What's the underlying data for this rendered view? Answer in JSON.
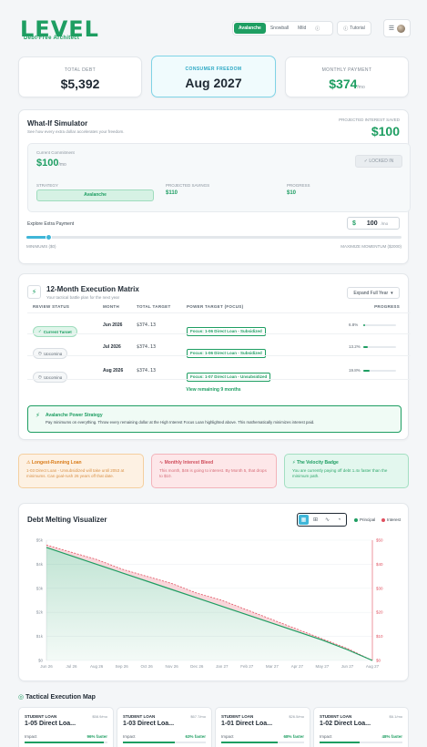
{
  "brand": {
    "name": "LEVEL",
    "tagline": "Debt-Free Architect"
  },
  "strategy_tabs": [
    {
      "label": "Avalanche",
      "active": true
    },
    {
      "label": "Snowball",
      "active": false
    },
    {
      "label": "Mild",
      "active": false
    }
  ],
  "tutorial_label": "Tutorial",
  "stats": {
    "total_debt": {
      "label": "TOTAL DEBT",
      "value": "$5,392"
    },
    "freedom": {
      "label": "CONSUMER FREEDOM",
      "value": "Aug 2027"
    },
    "payment": {
      "label": "MONTHLY PAYMENT",
      "value": "$374",
      "unit": "/mo"
    }
  },
  "simulator": {
    "title": "What-If Simulator",
    "subtitle": "See how every extra dollar accelerates your freedom.",
    "saved_label": "PROJECTED INTEREST SAVED",
    "saved_value": "$100",
    "commitment_label": "Current Commitment",
    "commitment_value": "$100",
    "commitment_unit": "/mo",
    "locked_label": "✓ LOCKED IN",
    "strategy_label": "STRATEGY",
    "strategy_value": "Avalanche",
    "savings_label": "PROJECTED SAVINGS",
    "savings_value": "$110",
    "progress_label": "PROGRESS",
    "progress_value": "$10",
    "explore_label": "Explore Extra Payment",
    "extra_currency": "$",
    "extra_value": "100",
    "extra_unit": "/mo",
    "slider_level": 0.06,
    "min_label": "MINIMUMS ($0)",
    "max_label": "MAXIMIZE MOMENTUM ($2000)"
  },
  "matrix": {
    "title": "12-Month Execution Matrix",
    "subtitle": "Your tactical battle plan for the next year",
    "expand_label": "Expand Full Year",
    "headers": [
      "REVIEW STATUS",
      "MONTH",
      "TOTAL TARGET",
      "POWER TARGET (FOCUS)",
      "PROGRESS"
    ],
    "rows": [
      {
        "status": "Current Target",
        "current": true,
        "month": "Jun 2026",
        "total": "$374.13",
        "focus": "Focus: 1-06 Direct Loan - Subsidized",
        "progress": "6.8%",
        "level": 0.068
      },
      {
        "status": "Upcoming",
        "current": false,
        "month": "Jul 2026",
        "total": "$374.13",
        "focus": "Focus: 1-06 Direct Loan - Subsidized",
        "progress": "13.2%",
        "level": 0.132
      },
      {
        "status": "Upcoming",
        "current": false,
        "month": "Aug 2026",
        "total": "$374.13",
        "focus": "Focus: 1-07 Direct Loan - Unsubsidized",
        "progress": "19.8%",
        "level": 0.198
      }
    ],
    "view_more": "View remaining 9 months",
    "strategy_title": "Avalanche Power Strategy",
    "strategy_body": "Pay minimums on everything. Throw every remaining dollar at the High Interest Focus Loan highlighted above. This mathematically minimizes interest paid."
  },
  "alerts": [
    {
      "title": "Longest-Running Loan",
      "body": "1-03 Direct Loan - Unsubsidized will take until 2053 at minimums. Can goal-rush 26 years off that date."
    },
    {
      "title": "Monthly Interest Bleed",
      "body": "This month, $46 is going to interest. By Month 5, that drops to $10."
    },
    {
      "title": "The Velocity Badge",
      "body": "You are currently paying off debt 1.4x faster than the minimum path."
    }
  ],
  "visualizer": {
    "title": "Debt Melting Visualizer",
    "legend_principal": "Principal",
    "legend_interest": "Interest"
  },
  "chart_data": {
    "type": "area",
    "x": [
      "Jun 26",
      "Jul 26",
      "Aug 26",
      "Sep 26",
      "Oct 26",
      "Nov 26",
      "Dec 26",
      "Jan 27",
      "Feb 27",
      "Mar 27",
      "Apr 27",
      "May 27",
      "Jun 27",
      "Aug 27"
    ],
    "series": [
      {
        "name": "Principal",
        "values": [
          4700,
          4350,
          4000,
          3650,
          3300,
          2950,
          2600,
          2250,
          1900,
          1550,
          1200,
          850,
          450,
          0
        ]
      },
      {
        "name": "Interest",
        "values": [
          48,
          45,
          42,
          38,
          35,
          32,
          28,
          25,
          21,
          17,
          13,
          9,
          5,
          0
        ]
      }
    ],
    "y_left_ticks": [
      "$0",
      "$1k",
      "$2k",
      "$3k",
      "$4k",
      "$5k"
    ],
    "y_right_ticks": [
      "$0",
      "$10",
      "$20",
      "$30",
      "$40",
      "$50"
    ],
    "ylim": [
      0,
      5000
    ],
    "y2lim": [
      0,
      50
    ]
  },
  "tactical": {
    "title": "Tactical Execution Map",
    "cards": [
      {
        "kind": "STUDENT LOAN",
        "balance": "$58.9/mo",
        "title": "1-05 Direct Loa...",
        "impact": "Impact",
        "faster": "96% faster",
        "level": 0.96
      },
      {
        "kind": "STUDENT LOAN",
        "balance": "$67.7/mo",
        "title": "1-03 Direct Loa...",
        "impact": "Impact",
        "faster": "63% faster",
        "level": 0.63
      },
      {
        "kind": "STUDENT LOAN",
        "balance": "$26.5/mo",
        "title": "1-01 Direct Loa...",
        "impact": "Impact",
        "faster": "68% faster",
        "level": 0.68
      },
      {
        "kind": "STUDENT LOAN",
        "balance": "$6.1/mo",
        "title": "1-02 Direct Loa...",
        "impact": "Impact",
        "faster": "48% faster",
        "level": 0.48
      }
    ]
  }
}
